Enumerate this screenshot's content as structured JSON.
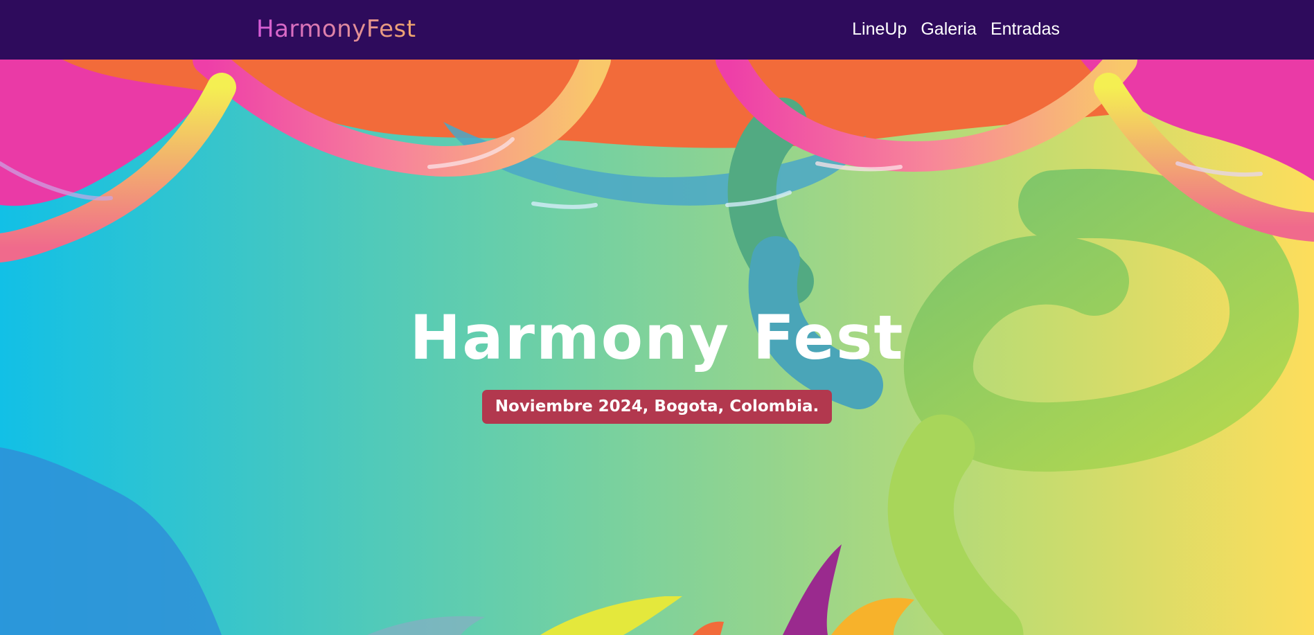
{
  "header": {
    "brand": "HarmonyFest",
    "nav": [
      {
        "label": "LineUp"
      },
      {
        "label": "Galeria"
      },
      {
        "label": "Entradas"
      }
    ]
  },
  "hero": {
    "title": "Harmony Fest",
    "subtitle": "Noviembre 2024, Bogota, Colombia."
  },
  "colors": {
    "navbar_bg": "#2e0b5c",
    "badge_bg": "#b2384e",
    "brand_gradient": [
      "#d65bd8",
      "#f0a86a"
    ],
    "hero_gradient": [
      "#12c0e6",
      "#6acfa8",
      "#c3dc70",
      "#fddd5c"
    ]
  }
}
